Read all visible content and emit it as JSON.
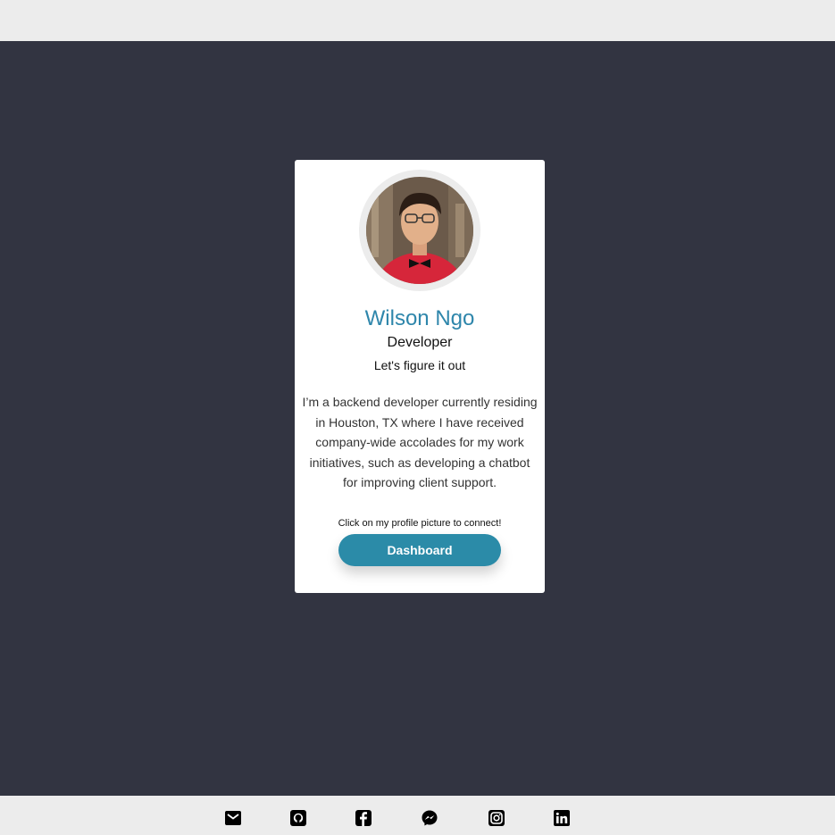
{
  "profile": {
    "name": "Wilson Ngo",
    "role": "Developer",
    "tagline": "Let's figure it out",
    "bio": "I’m a backend developer currently residing in Houston, TX where I have received company-wide accolades for my work initiatives, such as developing a chatbot for improving client support.",
    "hint": "Click on my profile picture to connect!",
    "dashboard_label": "Dashboard"
  },
  "colors": {
    "page_background": "#323441",
    "bar_background": "#ececec",
    "name_color": "#2e86ab",
    "button_color": "#2b8ba8"
  },
  "footer": {
    "icons": [
      "email-icon",
      "github-icon",
      "facebook-icon",
      "messenger-icon",
      "instagram-icon",
      "linkedin-icon"
    ]
  }
}
